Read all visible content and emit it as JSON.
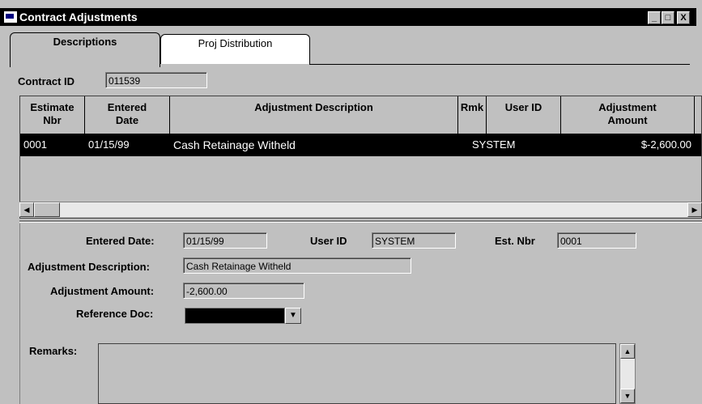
{
  "window": {
    "title": "Contract Adjustments",
    "minimize": "_",
    "maximize": "□",
    "close": "X"
  },
  "tabs": [
    {
      "label": "Descriptions",
      "active": true
    },
    {
      "label": "Proj Distribution",
      "active": false
    }
  ],
  "contract": {
    "label": "Contract ID",
    "value": "011539"
  },
  "grid": {
    "columns": [
      "Estimate Nbr",
      "Entered Date",
      "Adjustment Description",
      "Rmk",
      "User ID",
      "Adjustment Amount"
    ],
    "col_line1": [
      "Estimate",
      "Entered",
      "Adjustment Description",
      "Rmk",
      "User ID",
      "Adjustment"
    ],
    "col_line2": [
      "Nbr",
      "Date",
      "",
      "",
      "",
      "Amount"
    ],
    "rows": [
      {
        "estimate_nbr": "0001",
        "entered_date": "01/15/99",
        "description": "Cash Retainage Witheld",
        "rmk": "",
        "user_id": "SYSTEM",
        "amount": "$-2,600.00"
      }
    ],
    "scroll_left": "◀",
    "scroll_right": "▶"
  },
  "detail": {
    "entered_date_label": "Entered Date:",
    "entered_date": "01/15/99",
    "user_id_label": "User ID",
    "user_id": "SYSTEM",
    "est_nbr_label": "Est. Nbr",
    "est_nbr": "0001",
    "adj_desc_label": "Adjustment Description:",
    "adj_desc": "Cash Retainage Witheld",
    "adj_amount_label": "Adjustment Amount:",
    "adj_amount": "-2,600.00",
    "ref_doc_label": "Reference Doc:",
    "ref_doc": "",
    "ref_doc_arrow": "▼",
    "remarks_label": "Remarks:",
    "remarks": "",
    "scroll_up": "▲",
    "scroll_down": "▼"
  }
}
